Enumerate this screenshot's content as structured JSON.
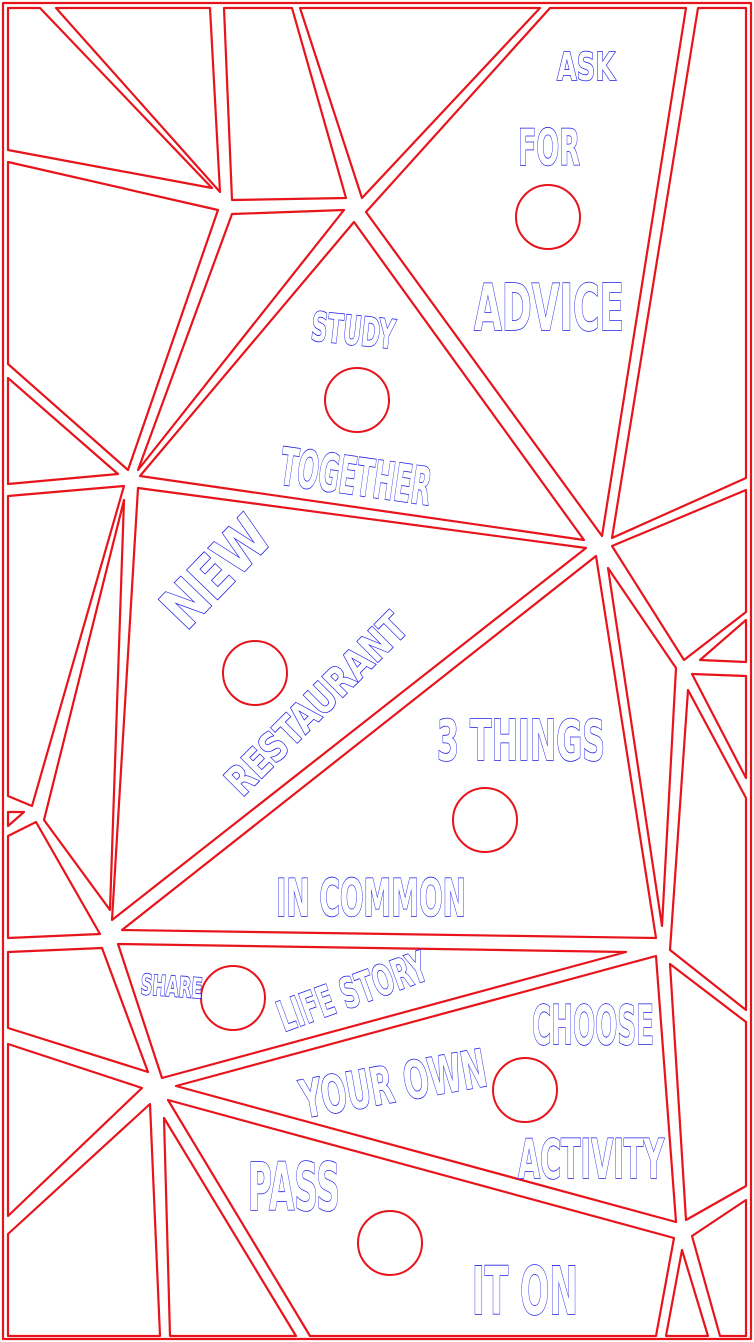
{
  "board": {
    "line_color": "#e8141c",
    "text_color": "#1a1ae6",
    "labels": {
      "ask": "ASK",
      "for": "FOR",
      "advice": "ADVICE",
      "study": "STUDY",
      "together": "TOGETHER",
      "new": "NEW",
      "restaurant": "RESTAURANT",
      "three_things": "3 THINGS",
      "in_common": "IN COMMON",
      "share": "SHARE",
      "life_story": "LIFE STORY",
      "choose": "CHOOSE",
      "your_own": "YOUR OWN",
      "activity": "ACTIVITY",
      "pass": "PASS",
      "it_on": "IT ON"
    }
  }
}
